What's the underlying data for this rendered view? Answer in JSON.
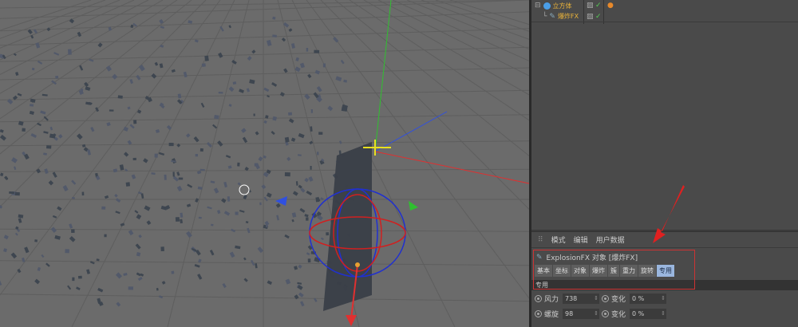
{
  "object_manager": {
    "objects": [
      {
        "name": "立方体",
        "icon": "cube-icon"
      },
      {
        "name": "爆炸FX",
        "icon": "explosion-fx-icon"
      }
    ]
  },
  "attributes": {
    "menu": [
      "模式",
      "编辑",
      "用户数据"
    ],
    "object_title": "ExplosionFX 对象 [爆炸FX]",
    "tabs": [
      "基本",
      "坐标",
      "对象",
      "爆炸",
      "簇",
      "重力",
      "旋转",
      "专用"
    ],
    "active_tab": "专用",
    "section": "专用",
    "fields": [
      {
        "label": "风力",
        "value": "738",
        "var_label": "变化",
        "var_value": "0 %"
      },
      {
        "label": "螺旋",
        "value": "98",
        "var_label": "变化",
        "var_value": "0 %"
      }
    ]
  },
  "colors": {
    "x_axis": "#e03030",
    "y_axis": "#30c030",
    "z_axis": "#3050e0",
    "highlight": "#c33"
  }
}
